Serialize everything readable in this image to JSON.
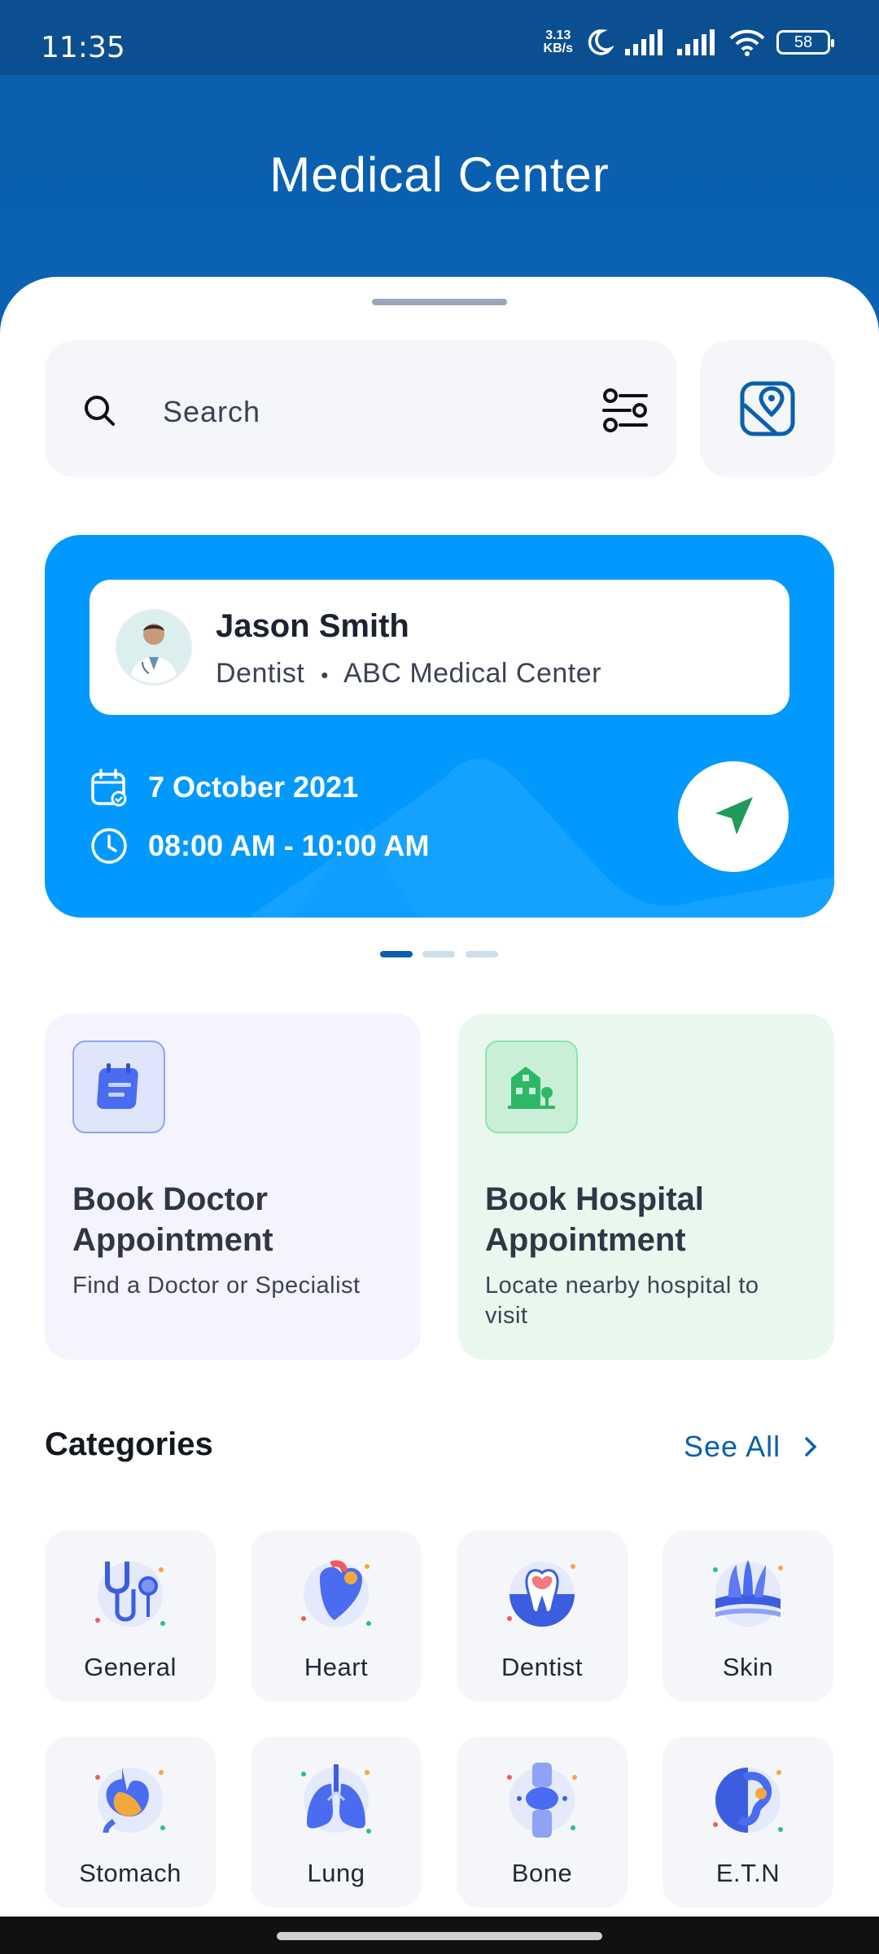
{
  "status_bar": {
    "time": "11:35",
    "net_speed_value": "3.13",
    "net_speed_unit": "KB/s",
    "battery": "58"
  },
  "header": {
    "title": "Medical Center"
  },
  "search": {
    "placeholder": "Search"
  },
  "appointment": {
    "doctor_name": "Jason Smith",
    "doctor_specialty": "Dentist",
    "separator": "•",
    "center": "ABC Medical Center",
    "date": "7 October 2021",
    "time": "08:00 AM - 10:00 AM"
  },
  "pager": {
    "count": 3,
    "active": 1
  },
  "booking": {
    "doctor": {
      "title": "Book Doctor Appointment",
      "subtitle": "Find a Doctor or Specialist"
    },
    "hospital": {
      "title": "Book Hospital Appointment",
      "subtitle": "Locate nearby hospital to visit"
    }
  },
  "categories": {
    "heading": "Categories",
    "see_all": "See All",
    "items": [
      {
        "label": "General",
        "icon": "stethoscope-icon"
      },
      {
        "label": "Heart",
        "icon": "heart-icon"
      },
      {
        "label": "Dentist",
        "icon": "tooth-icon"
      },
      {
        "label": "Skin",
        "icon": "skin-icon"
      },
      {
        "label": "Stomach",
        "icon": "stomach-icon"
      },
      {
        "label": "Lung",
        "icon": "lung-icon"
      },
      {
        "label": "Bone",
        "icon": "bone-icon"
      },
      {
        "label": "E.T.N",
        "icon": "ear-icon"
      }
    ]
  },
  "colors": {
    "brand_blue": "#0b5fae",
    "card_blue": "#0299fe",
    "accent_green": "#1f9a5a"
  }
}
